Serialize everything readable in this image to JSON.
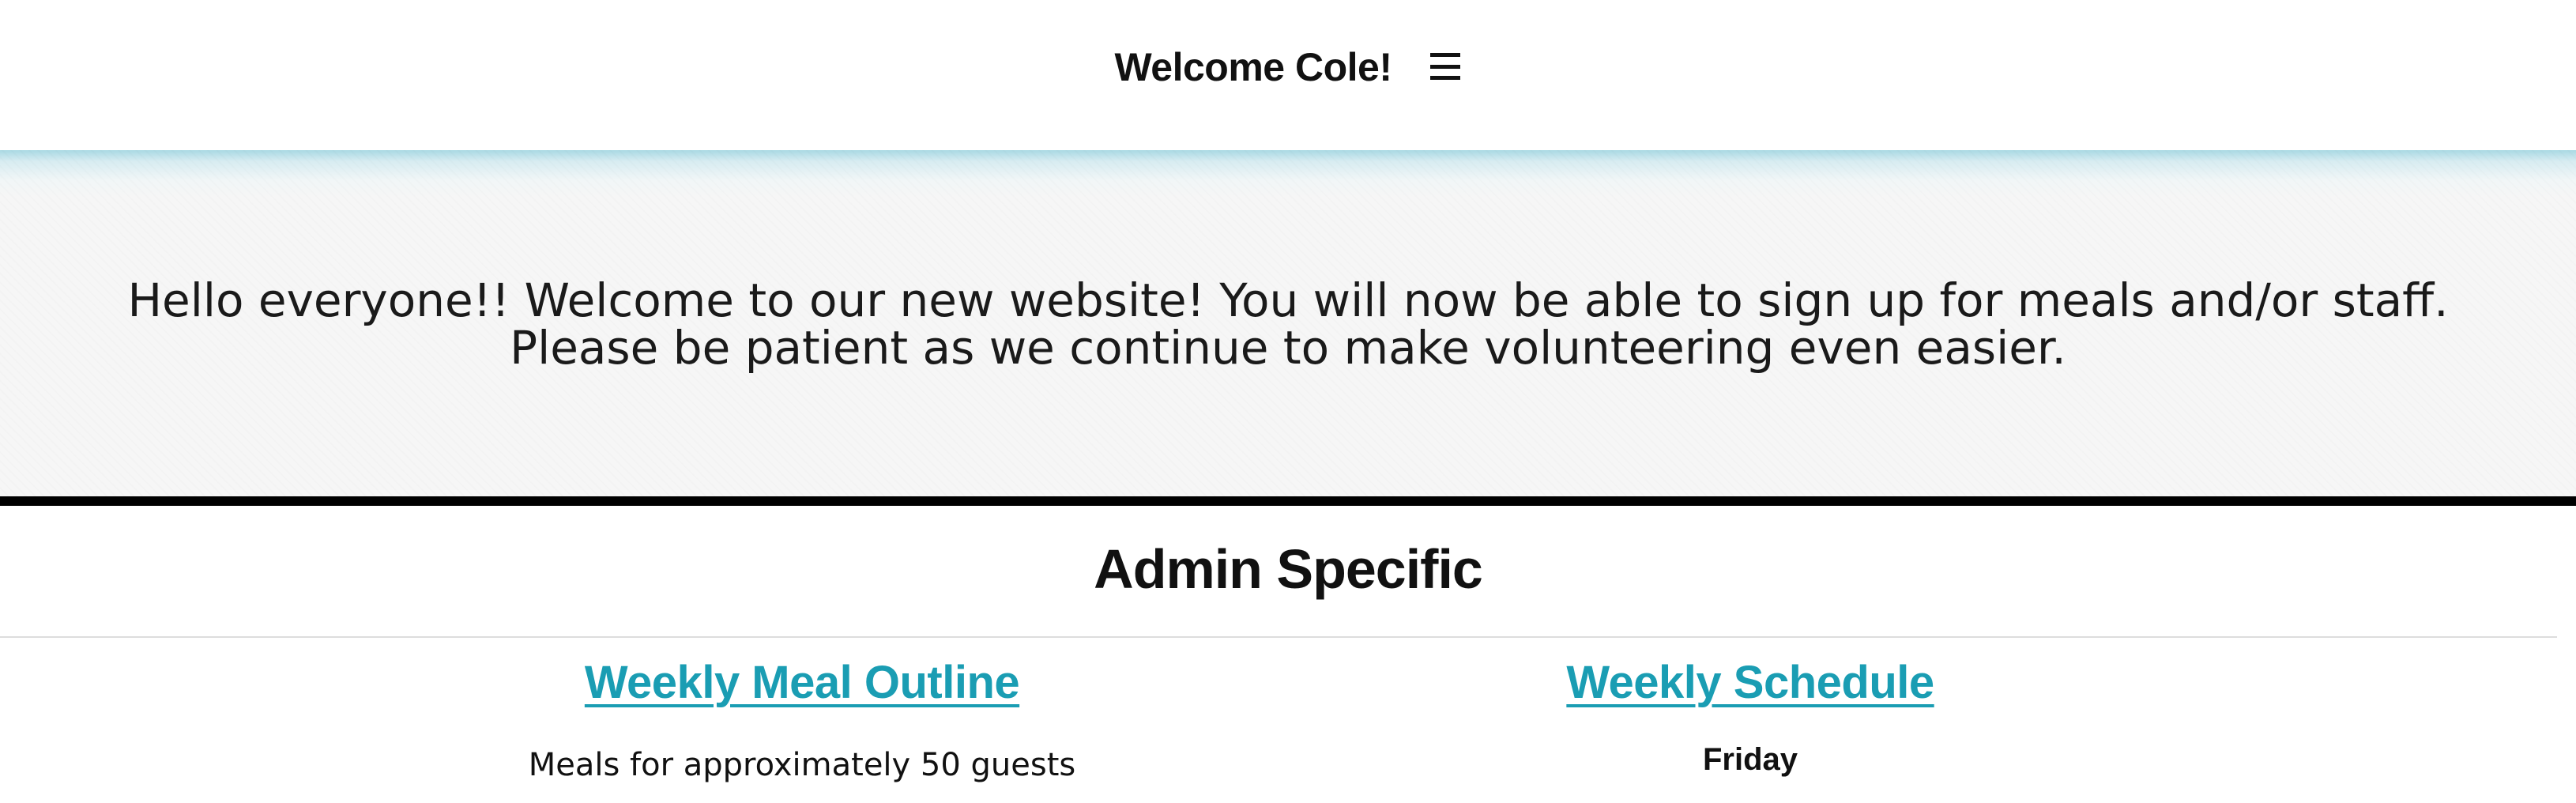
{
  "header": {
    "title": "Welcome Cole!",
    "menu_icon": "hamburger-menu-icon"
  },
  "banner": {
    "message": "Hello everyone!! Welcome to our new website! You will now be able to sign up for meals and/or staff. Please be patient as we continue to make volunteering even easier."
  },
  "admin": {
    "title": "Admin Specific",
    "left": {
      "link_label": "Weekly Meal Outline",
      "subtitle": "Meals for approximately 50 guests"
    },
    "right": {
      "link_label": "Weekly Schedule",
      "day": "Friday"
    }
  },
  "colors": {
    "link": "#1a9db3",
    "banner_bg": "#f6f6f6",
    "banner_top": "#a9d9e3"
  }
}
